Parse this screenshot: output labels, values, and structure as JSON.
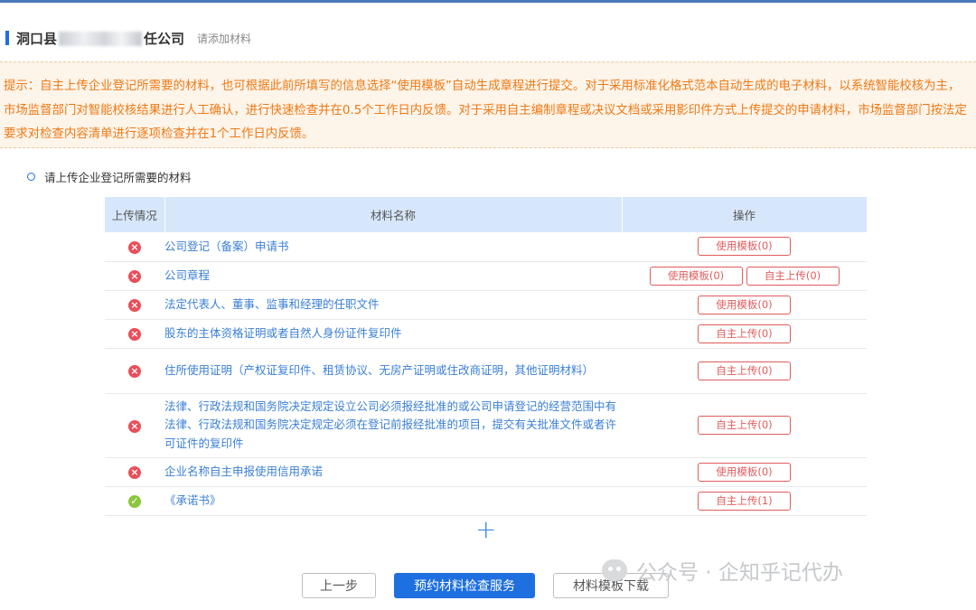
{
  "header": {
    "title_prefix": "洞口县",
    "title_suffix": "任公司",
    "subtitle": "请添加材料"
  },
  "notice": {
    "text": "提示：自主上传企业登记所需要的材料，也可根据此前所填写的信息选择“使用模板”自动生成章程进行提交。对于采用标准化格式范本自动生成的电子材料，以系统智能校核为主，市场监督部门对智能校核结果进行人工确认，进行快速检查并在0.5个工作日内反馈。对于采用自主编制章程或决议文档或采用影印件方式上传提交的申请材料，市场监督部门按法定要求对检查内容清单进行逐项检查并在1个工作日内反馈。"
  },
  "section": {
    "title": "请上传企业登记所需要的材料"
  },
  "table": {
    "headers": {
      "status": "上传情况",
      "name": "材料名称",
      "ops": "操作"
    },
    "rows": [
      {
        "status": "error",
        "name": "公司登记（备案）申请书",
        "buttons": [
          "使用模板(0)"
        ]
      },
      {
        "status": "error",
        "name": "公司章程",
        "buttons": [
          "使用模板(0)",
          "自主上传(0)"
        ]
      },
      {
        "status": "error",
        "name": "法定代表人、董事、监事和经理的任职文件",
        "buttons": [
          "使用模板(0)"
        ]
      },
      {
        "status": "error",
        "name": "股东的主体资格证明或者自然人身份证件复印件",
        "buttons": [
          "自主上传(0)"
        ]
      },
      {
        "status": "error",
        "name": "住所使用证明（产权证复印件、租赁协议、无房产证明或住改商证明，其他证明材料）",
        "buttons": [
          "自主上传(0)"
        ]
      },
      {
        "status": "error",
        "name": "法律、行政法规和国务院决定规定设立公司必须报经批准的或公司申请登记的经营范围中有法律、行政法规和国务院决定规定必须在登记前报经批准的项目，提交有关批准文件或者许可证件的复印件",
        "buttons": [
          "自主上传(0)"
        ]
      },
      {
        "status": "error",
        "name": "企业名称自主申报使用信用承诺",
        "buttons": [
          "使用模板(0)"
        ]
      },
      {
        "status": "ok",
        "name": "《承诺书》",
        "buttons": [
          "自主上传(1)"
        ]
      }
    ]
  },
  "add_icon": "+",
  "footer": {
    "prev": "上一步",
    "primary": "预约材料检查服务",
    "template": "材料模板下载"
  },
  "watermark": {
    "text": "公众号 · 企知乎记代办"
  },
  "icons": {
    "error": "×",
    "ok": "✓"
  },
  "colors": {
    "accent": "#1e6fe0",
    "error": "#e8505b",
    "ok": "#8cc63f",
    "notice": "#ee7a15",
    "link": "#3a7fd5"
  }
}
